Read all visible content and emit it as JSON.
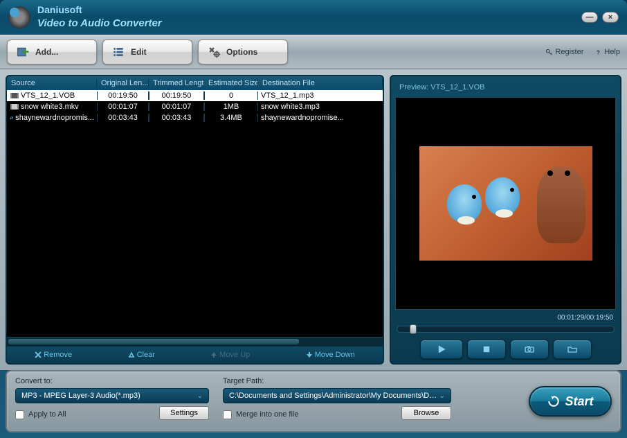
{
  "title": {
    "brand": "Daniusoft",
    "subtitle": "Video to Audio Converter"
  },
  "window": {
    "minimize": "—",
    "close": "×"
  },
  "toolbar": {
    "add": "Add...",
    "edit": "Edit",
    "options": "Options",
    "register": "Register",
    "help": "Help"
  },
  "columns": {
    "source": "Source",
    "origLen": "Original Len...",
    "trimLen": "Trimmed Length",
    "estSize": "Estimated Size",
    "destFile": "Destination File"
  },
  "files": [
    {
      "name": "VTS_12_1.VOB",
      "orig": "00:19:50",
      "trim": "00:19:50",
      "size": "0",
      "dest": "VTS_12_1.mp3",
      "selected": true,
      "type": "video"
    },
    {
      "name": "snow white3.mkv",
      "orig": "00:01:07",
      "trim": "00:01:07",
      "size": "1MB",
      "dest": "snow white3.mp3",
      "selected": false,
      "type": "video"
    },
    {
      "name": "shaynewardnopromis...",
      "orig": "00:03:43",
      "trim": "00:03:43",
      "size": "3.4MB",
      "dest": "shaynewardnopromise...",
      "selected": false,
      "type": "audio"
    }
  ],
  "listActions": {
    "remove": "Remove",
    "clear": "Clear",
    "moveUp": "Move Up",
    "moveDown": "Move Down"
  },
  "preview": {
    "label": "Preview: VTS_12_1.VOB",
    "time": "00:01:29/00:19:50"
  },
  "bottom": {
    "convertToLabel": "Convert to:",
    "convertTo": "MP3 - MPEG Layer-3 Audio(*.mp3)",
    "applyToAll": "Apply to All",
    "settings": "Settings",
    "targetPathLabel": "Target Path:",
    "targetPath": "C:\\Documents and Settings\\Administrator\\My Documents\\Daniu",
    "mergeIntoOne": "Merge into one file",
    "browse": "Browse",
    "start": "Start"
  }
}
